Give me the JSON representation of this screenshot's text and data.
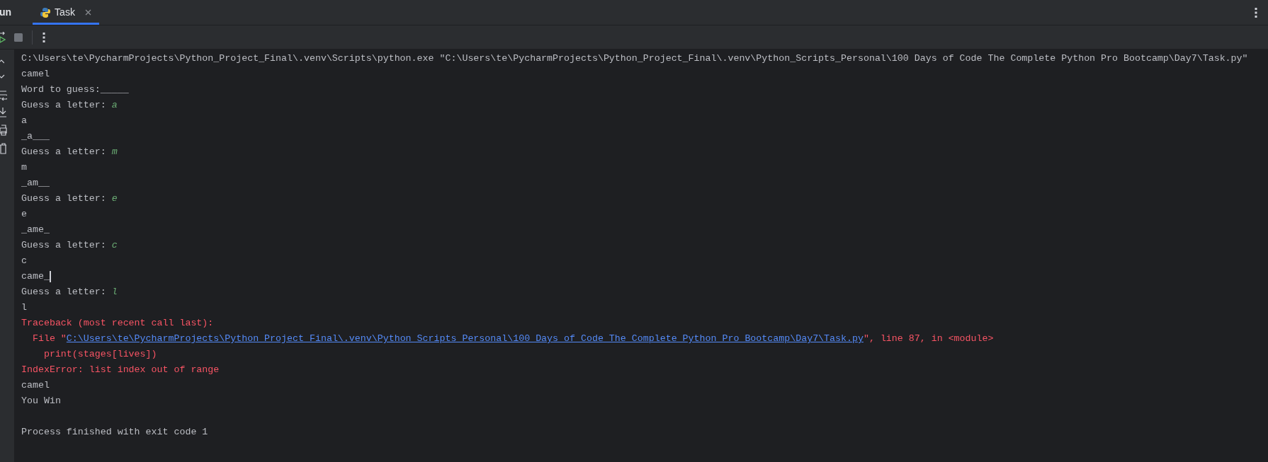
{
  "tool_window": {
    "title_partial": "un"
  },
  "tabs": [
    {
      "label": "Task",
      "selected": true
    }
  ],
  "console": {
    "lines": [
      {
        "kind": "command",
        "text": "C:\\Users\\te\\PycharmProjects\\Python_Project_Final\\.venv\\Scripts\\python.exe \"C:\\Users\\te\\PycharmProjects\\Python_Project_Final\\.venv\\Python_Scripts_Personal\\100 Days of Code The Complete Python Pro Bootcamp\\Day7\\Task.py\"",
        "cursor": false
      },
      {
        "kind": "output",
        "text": "camel",
        "cursor": false
      },
      {
        "kind": "output",
        "text": "Word to guess:_____",
        "cursor": false
      },
      {
        "kind": "prompt",
        "text": "Guess a letter: ",
        "input": "a",
        "cursor": false
      },
      {
        "kind": "output",
        "text": "a",
        "cursor": false
      },
      {
        "kind": "output",
        "text": "_a___",
        "cursor": false
      },
      {
        "kind": "prompt",
        "text": "Guess a letter: ",
        "input": "m",
        "cursor": false
      },
      {
        "kind": "output",
        "text": "m",
        "cursor": false
      },
      {
        "kind": "output",
        "text": "_am__",
        "cursor": false
      },
      {
        "kind": "prompt",
        "text": "Guess a letter: ",
        "input": "e",
        "cursor": false
      },
      {
        "kind": "output",
        "text": "e",
        "cursor": false
      },
      {
        "kind": "output",
        "text": "_ame_",
        "cursor": false
      },
      {
        "kind": "prompt",
        "text": "Guess a letter: ",
        "input": "c",
        "cursor": false
      },
      {
        "kind": "output",
        "text": "c",
        "cursor": false
      },
      {
        "kind": "output",
        "text": "came_",
        "cursor": true
      },
      {
        "kind": "prompt",
        "text": "Guess a letter: ",
        "input": "l",
        "cursor": false
      },
      {
        "kind": "output",
        "text": "l",
        "cursor": false
      },
      {
        "kind": "error",
        "text": "Traceback (most recent call last):",
        "cursor": false
      },
      {
        "kind": "file_ref",
        "prefix": "  File \"",
        "link": "C:\\Users\\te\\PycharmProjects\\Python_Project_Final\\.venv\\Python_Scripts_Personal\\100 Days of Code The Complete Python Pro Bootcamp\\Day7\\Task.py",
        "suffix": "\", line 87, in <module>",
        "cursor": false
      },
      {
        "kind": "error",
        "text": "    print(stages[lives])",
        "cursor": false
      },
      {
        "kind": "error",
        "text": "IndexError: list index out of range",
        "cursor": false
      },
      {
        "kind": "output",
        "text": "camel",
        "cursor": false
      },
      {
        "kind": "output",
        "text": "You Win",
        "cursor": false
      },
      {
        "kind": "blank",
        "cursor": false
      },
      {
        "kind": "output",
        "text": "Process finished with exit code 1",
        "cursor": false
      }
    ]
  }
}
